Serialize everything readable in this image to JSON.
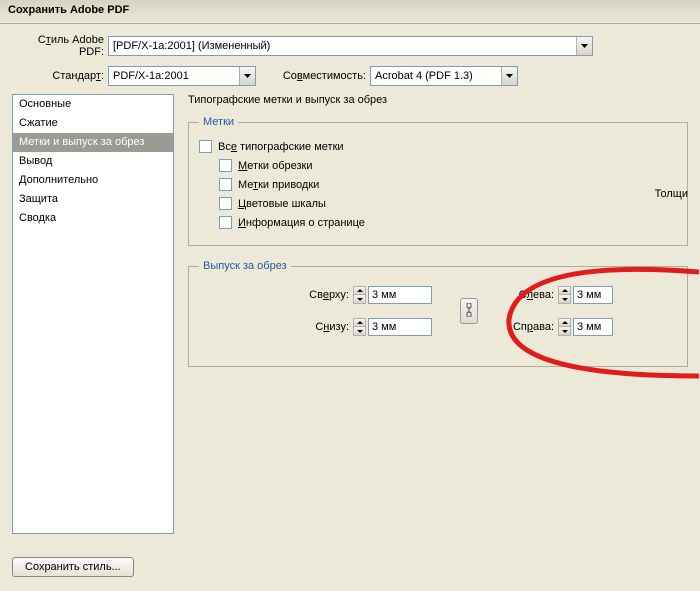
{
  "window": {
    "title": "Сохранить Adobe PDF"
  },
  "top": {
    "style_label_pre": "С",
    "style_label_u": "т",
    "style_label_post": "иль Adobe PDF:",
    "style_value": "[PDF/X-1a:2001] (Измененный)",
    "standard_label_pre": "Стандар",
    "standard_label_u": "т",
    "standard_label_post": ":",
    "standard_value": "PDF/X-1a:2001",
    "compat_label_pre": "Со",
    "compat_label_u": "в",
    "compat_label_post": "местимость:",
    "compat_value": "Acrobat 4 (PDF 1.3)"
  },
  "sidebar": {
    "items": [
      {
        "label": "Основные"
      },
      {
        "label": "Сжатие"
      },
      {
        "label": "Метки и выпуск за обрез"
      },
      {
        "label": "Вывод"
      },
      {
        "label": "Дополнительно"
      },
      {
        "label": "Защита"
      },
      {
        "label": "Сводка"
      }
    ],
    "selected": 2
  },
  "panel": {
    "title": "Типографские метки и выпуск за обрез",
    "marks": {
      "legend": "Метки",
      "all_pre": "Вс",
      "all_u": "е",
      "all_post": " типографские метки",
      "trim_u": "М",
      "trim_post": "етки обрезки",
      "reg_pre": "Ме",
      "reg_u": "т",
      "reg_post": "ки приводки",
      "color_u": "Ц",
      "color_post": "ветовые шкалы",
      "page_u": "И",
      "page_post": "нформация о странице",
      "thickness_label": "Толщи"
    },
    "bleed": {
      "legend": "Выпуск за обрез",
      "top_pre": "Св",
      "top_u": "е",
      "top_post": "рху:",
      "bottom_pre": "С",
      "bottom_u": "н",
      "bottom_post": "изу:",
      "left_pre": "С",
      "left_u": "л",
      "left_post": "ева:",
      "right_pre": "Сп",
      "right_u": "р",
      "right_post": "ава:",
      "top_val": "3 мм",
      "bottom_val": "3 мм",
      "left_val": "3 мм",
      "right_val": "3 мм"
    }
  },
  "buttons": {
    "save_style": "Сохранить стиль..."
  }
}
